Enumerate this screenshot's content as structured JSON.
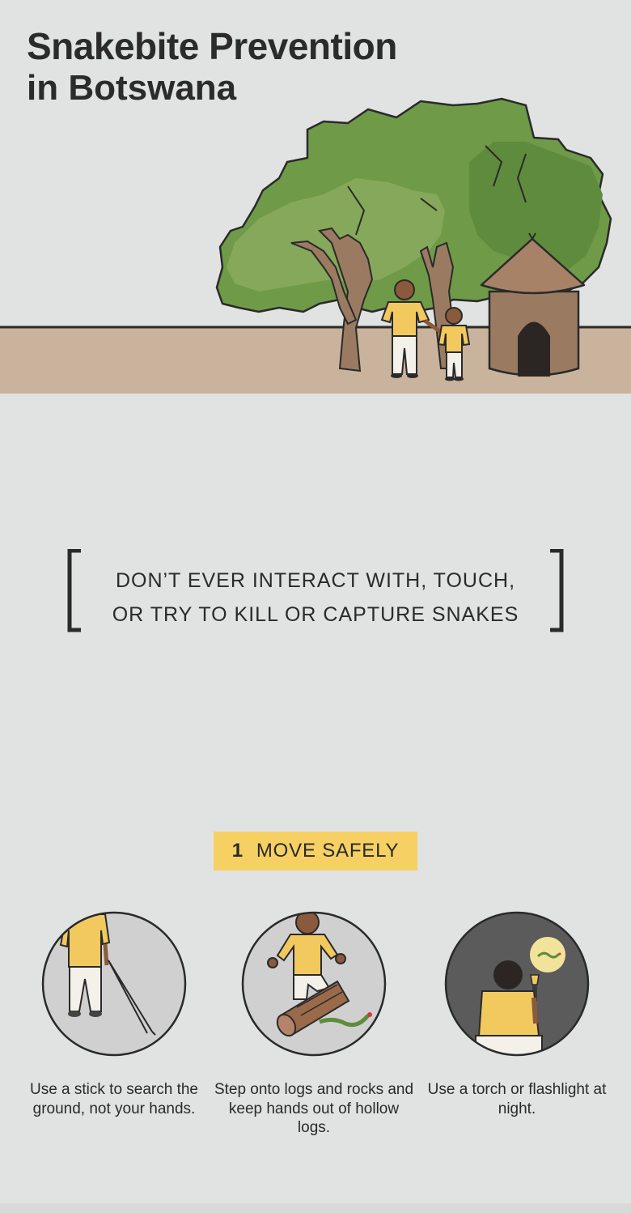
{
  "header": {
    "title_line1": "Snakebite Prevention",
    "title_line2": "in Botswana"
  },
  "hero": {
    "illustration": "tree-hut-family-illustration"
  },
  "quote": {
    "line1": "DON’T EVER INTERACT WITH, TOUCH,",
    "line2": "OR TRY TO KILL OR CAPTURE SNAKES"
  },
  "section": {
    "number": "1",
    "title": "MOVE SAFELY"
  },
  "tips": [
    {
      "icon": "person-with-stick-icon",
      "caption": "Use a stick to search the ground, not your hands."
    },
    {
      "icon": "person-stepping-on-log-icon",
      "caption": "Step onto logs and rocks and keep hands out of hollow logs."
    },
    {
      "icon": "person-with-torch-icon",
      "caption": "Use a torch or flashlight at night."
    }
  ],
  "colors": {
    "background": "#e1e2e2",
    "ground": "#c9b39c",
    "tree_green": "#6f9a48",
    "shirt_yellow": "#f2c95e",
    "label_yellow": "#f7d063",
    "hut_brown": "#9a7b62"
  }
}
